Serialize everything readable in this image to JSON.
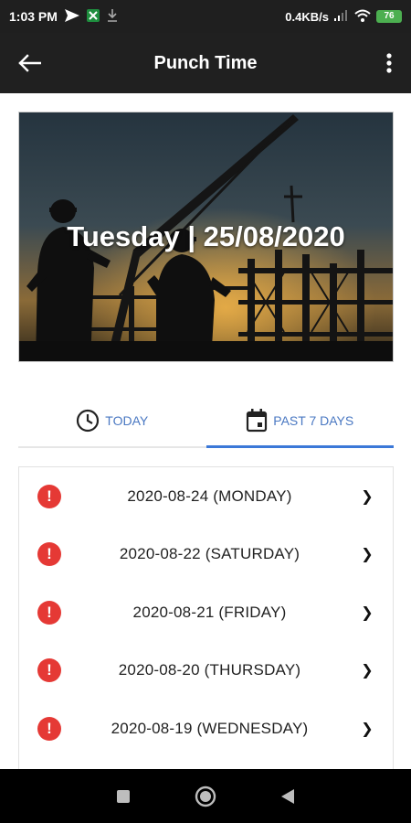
{
  "status_bar": {
    "time": "1:03 PM",
    "network_speed": "0.4KB/s",
    "battery_level": "76",
    "icons": [
      "send-icon",
      "spreadsheet-icon",
      "download-icon",
      "signal-icon",
      "wifi-icon",
      "battery-icon"
    ]
  },
  "app_bar": {
    "title": "Punch Time",
    "back_icon": "arrow-left-icon",
    "menu_icon": "more-vert-icon"
  },
  "hero": {
    "date_text": "Tuesday | 25/08/2020"
  },
  "tabs": [
    {
      "label": "TODAY",
      "icon": "clock-icon",
      "selected": false
    },
    {
      "label": "PAST 7 DAYS",
      "icon": "calendar-icon",
      "selected": true
    }
  ],
  "colors": {
    "tab_text": "#4a78c2",
    "tab_indicator": "#3b78d8",
    "alert": "#e53935",
    "app_bar": "#202020"
  },
  "days": [
    {
      "label": "2020-08-24 (MONDAY)"
    },
    {
      "label": "2020-08-22 (SATURDAY)"
    },
    {
      "label": "2020-08-21 (FRIDAY)"
    },
    {
      "label": "2020-08-20 (THURSDAY)"
    },
    {
      "label": "2020-08-19 (WEDNESDAY)"
    }
  ],
  "alert_glyph": "!",
  "chevron_glyph": "❯"
}
